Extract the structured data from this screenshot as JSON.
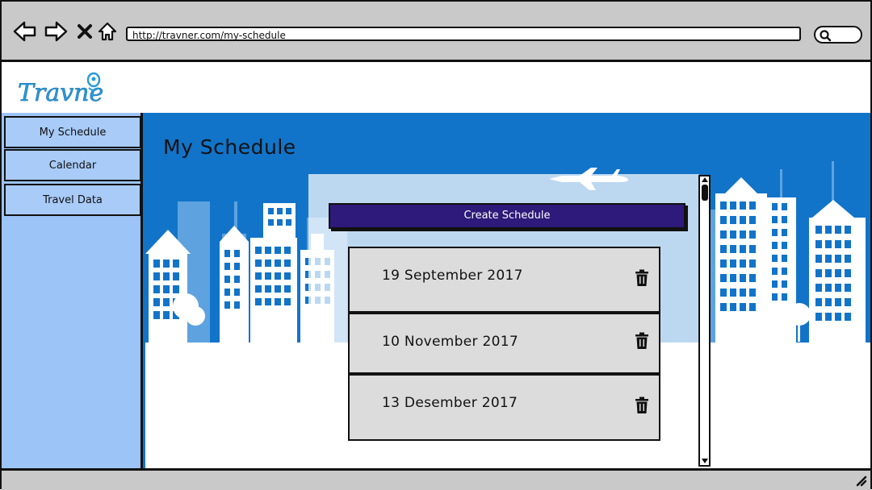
{
  "browser": {
    "url": "http://travner.com/my-schedule"
  },
  "header": {
    "logo_text": "Travner"
  },
  "sidebar": {
    "items": [
      {
        "label": "My Schedule"
      },
      {
        "label": "Calendar"
      },
      {
        "label": "Travel Data"
      }
    ]
  },
  "main": {
    "title": "My Schedule",
    "create_button_label": "Create Schedule",
    "schedules": [
      {
        "date": "19 September 2017"
      },
      {
        "date": "10 November 2017"
      },
      {
        "date": "13 Desember 2017"
      }
    ]
  },
  "colors": {
    "accent_blue": "#1174c9",
    "sidebar_blue": "#9dc4f7",
    "button_purple": "#2e1a7a",
    "card_gray": "#dcdcdc",
    "chrome_gray": "#c9c9c9"
  },
  "icons": [
    "back-arrow-icon",
    "forward-arrow-icon",
    "close-icon",
    "home-icon",
    "search-icon",
    "trash-icon",
    "airplane-icon",
    "resize-grip-icon"
  ]
}
